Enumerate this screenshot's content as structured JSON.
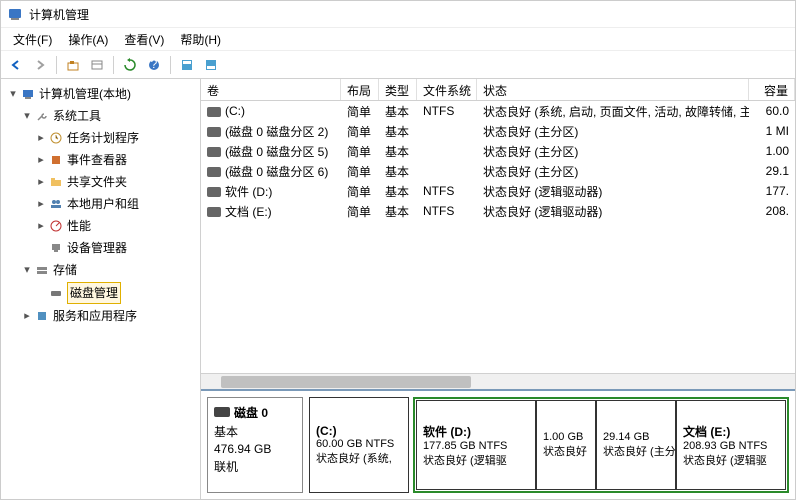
{
  "window": {
    "title": "计算机管理"
  },
  "menu": {
    "file": "文件(F)",
    "action": "操作(A)",
    "view": "查看(V)",
    "help": "帮助(H)"
  },
  "tree": {
    "root": "计算机管理(本地)",
    "system_tools": "系统工具",
    "task_scheduler": "任务计划程序",
    "event_viewer": "事件查看器",
    "shared_folders": "共享文件夹",
    "local_users": "本地用户和组",
    "performance": "性能",
    "device_manager": "设备管理器",
    "storage": "存储",
    "disk_mgmt": "磁盘管理",
    "services_apps": "服务和应用程序"
  },
  "grid": {
    "headers": {
      "volume": "卷",
      "layout": "布局",
      "type": "类型",
      "fs": "文件系统",
      "status": "状态",
      "capacity": "容量"
    },
    "rows": [
      {
        "volume": "(C:)",
        "layout": "简单",
        "type": "基本",
        "fs": "NTFS",
        "status": "状态良好 (系统, 启动, 页面文件, 活动, 故障转储, 主分区)",
        "capacity": "60.0"
      },
      {
        "volume": "(磁盘 0 磁盘分区 2)",
        "layout": "简单",
        "type": "基本",
        "fs": "",
        "status": "状态良好 (主分区)",
        "capacity": "1 MI"
      },
      {
        "volume": "(磁盘 0 磁盘分区 5)",
        "layout": "简单",
        "type": "基本",
        "fs": "",
        "status": "状态良好 (主分区)",
        "capacity": "1.00"
      },
      {
        "volume": "(磁盘 0 磁盘分区 6)",
        "layout": "简单",
        "type": "基本",
        "fs": "",
        "status": "状态良好 (主分区)",
        "capacity": "29.1"
      },
      {
        "volume": "软件 (D:)",
        "layout": "简单",
        "type": "基本",
        "fs": "NTFS",
        "status": "状态良好 (逻辑驱动器)",
        "capacity": "177."
      },
      {
        "volume": "文档 (E:)",
        "layout": "简单",
        "type": "基本",
        "fs": "NTFS",
        "status": "状态良好 (逻辑驱动器)",
        "capacity": "208."
      }
    ]
  },
  "disk": {
    "name": "磁盘 0",
    "type": "基本",
    "size": "476.94 GB",
    "status": "联机",
    "partitions": [
      {
        "name": "(C:)",
        "size": "60.00 GB NTFS",
        "status": "状态良好 (系统,"
      },
      {
        "name": "软件  (D:)",
        "size": "177.85 GB NTFS",
        "status": "状态良好 (逻辑驱"
      },
      {
        "name": "",
        "size": "1.00 GB",
        "status": "状态良好"
      },
      {
        "name": "",
        "size": "29.14 GB",
        "status": "状态良好 (主分"
      },
      {
        "name": "文档  (E:)",
        "size": "208.93 GB NTFS",
        "status": "状态良好 (逻辑驱"
      }
    ]
  }
}
